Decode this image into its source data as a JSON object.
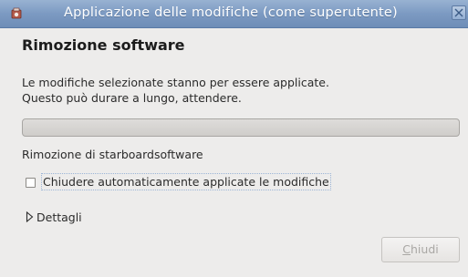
{
  "window": {
    "title": "Applicazione delle modifiche (come superutente)"
  },
  "dialog": {
    "heading": "Rimozione software",
    "description_line1": "Le modifiche selezionate stanno per essere applicate.",
    "description_line2": "Questo può durare a lungo, attendere.",
    "progress_fraction": 0,
    "status": "Rimozione di starboardsoftware",
    "auto_close_checkbox": {
      "label": "Chiudere automaticamente applicate le modifiche",
      "checked": false
    },
    "details_label": "Dettagli",
    "close_button": {
      "mnemonic": "C",
      "rest": "hiudi",
      "enabled": false
    }
  },
  "icons": {
    "app": "package-manager-icon",
    "close": "close-icon",
    "expander": "triangle-right-icon"
  },
  "colors": {
    "titlebar": "#7c9ac2",
    "background": "#edeceb",
    "disabled_text": "#a9a7a4"
  }
}
